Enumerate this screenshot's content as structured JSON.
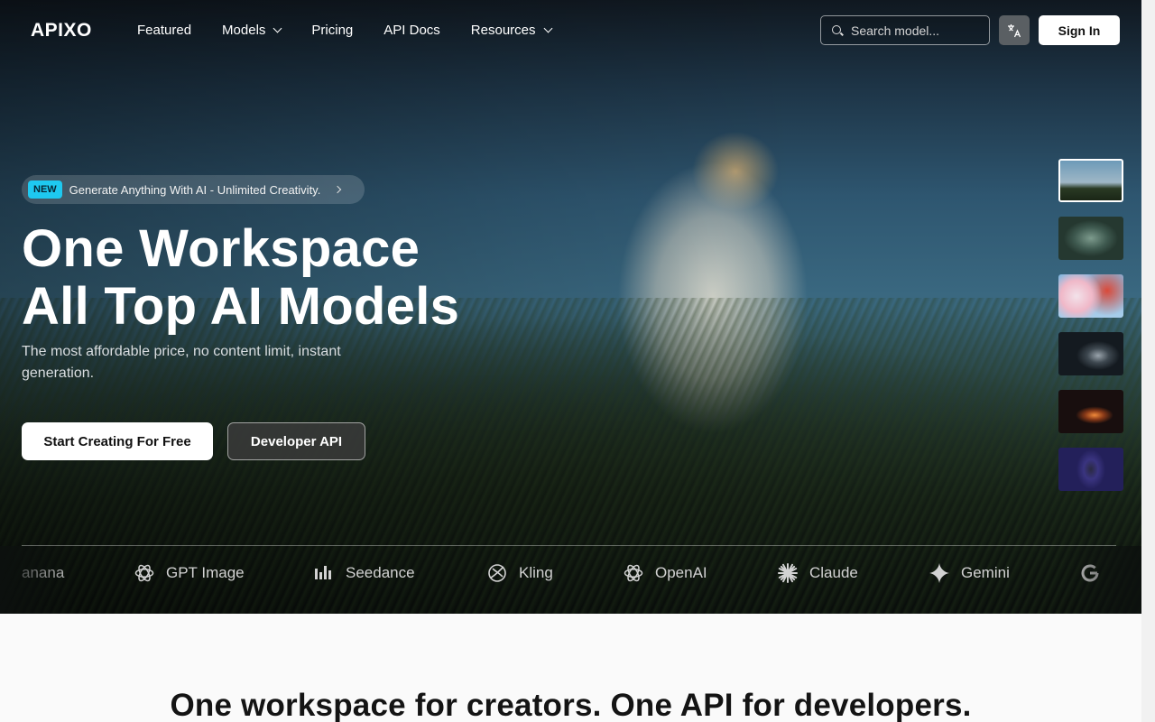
{
  "nav": {
    "logo": "APIXO",
    "links": [
      {
        "label": "Featured",
        "dropdown": false
      },
      {
        "label": "Models",
        "dropdown": true
      },
      {
        "label": "Pricing",
        "dropdown": false
      },
      {
        "label": "API Docs",
        "dropdown": false
      },
      {
        "label": "Resources",
        "dropdown": true
      }
    ],
    "search_placeholder": "Search model...",
    "lang_icon": "translate-icon",
    "signin_label": "Sign In"
  },
  "hero": {
    "badge_tag": "NEW",
    "badge_text": "Generate Anything With AI - Unlimited Creativity.",
    "headline_line1": "One Workspace",
    "headline_line2": "All Top AI Models",
    "subline": "The most affordable price, no content limit, instant generation.",
    "primary_cta": "Start Creating For Free",
    "secondary_cta": "Developer API",
    "accent_color": "#1ec9f0"
  },
  "thumbnails": [
    "runner-in-field",
    "forest-scene",
    "flowers",
    "futuristic-vehicle",
    "fire-motion",
    "dancer-portrait"
  ],
  "models": [
    {
      "name": "anana",
      "icon": "banana-icon"
    },
    {
      "name": "GPT Image",
      "icon": "openai-icon"
    },
    {
      "name": "Seedance",
      "icon": "bars-icon"
    },
    {
      "name": "Kling",
      "icon": "kling-icon"
    },
    {
      "name": "OpenAI",
      "icon": "openai-icon"
    },
    {
      "name": "Claude",
      "icon": "claude-icon"
    },
    {
      "name": "Gemini",
      "icon": "gemini-icon"
    },
    {
      "name": "",
      "icon": "google-icon"
    }
  ],
  "lower": {
    "title": "One workspace for creators. One API for developers."
  }
}
